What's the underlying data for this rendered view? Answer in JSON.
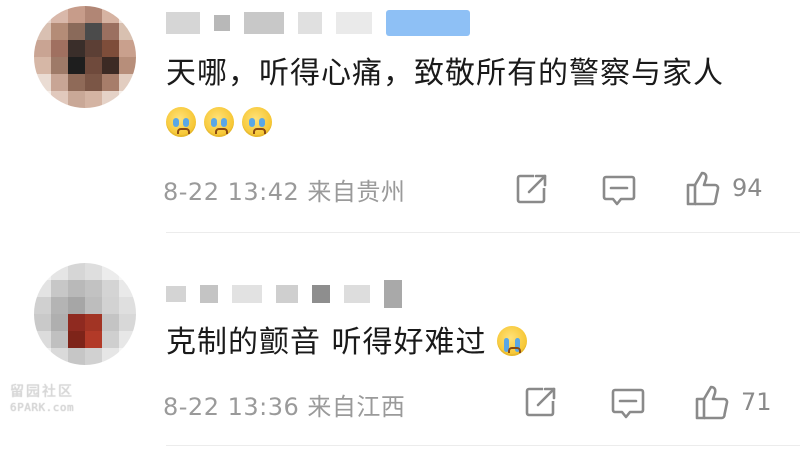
{
  "comments": [
    {
      "text": "天哪，听得心痛，致敬所有的警察与家人",
      "emojis": [
        "sad-face-emoji",
        "sad-face-emoji",
        "sad-face-emoji"
      ],
      "date": "8-22",
      "time": "13:42",
      "location": "来自贵州",
      "likes": "94",
      "icons": {
        "edit": "edit-icon",
        "reply": "message-icon",
        "like": "thumbs-up-icon"
      }
    },
    {
      "text": "克制的颤音  听得好难过",
      "emojis": [
        "crying-face-emoji"
      ],
      "date": "8-22",
      "time": "13:36",
      "location": "来自江西",
      "likes": "71",
      "icons": {
        "edit": "edit-icon",
        "reply": "message-icon",
        "like": "thumbs-up-icon"
      }
    }
  ],
  "watermark": {
    "line1": "留园社区",
    "line2": "6PARK.com"
  },
  "colors": {
    "text": "#1a1a1a",
    "meta": "#9a9a9a",
    "icon": "#8a8a8a",
    "highlight": "#8ec0f5"
  }
}
